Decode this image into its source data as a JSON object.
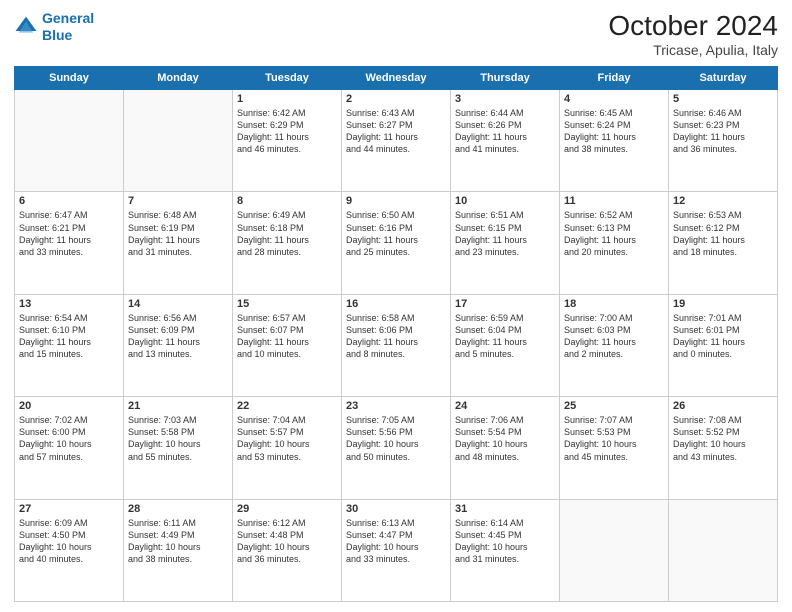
{
  "header": {
    "logo_line1": "General",
    "logo_line2": "Blue",
    "month": "October 2024",
    "location": "Tricase, Apulia, Italy"
  },
  "weekdays": [
    "Sunday",
    "Monday",
    "Tuesday",
    "Wednesday",
    "Thursday",
    "Friday",
    "Saturday"
  ],
  "weeks": [
    [
      {
        "day": "",
        "text": ""
      },
      {
        "day": "",
        "text": ""
      },
      {
        "day": "1",
        "text": "Sunrise: 6:42 AM\nSunset: 6:29 PM\nDaylight: 11 hours\nand 46 minutes."
      },
      {
        "day": "2",
        "text": "Sunrise: 6:43 AM\nSunset: 6:27 PM\nDaylight: 11 hours\nand 44 minutes."
      },
      {
        "day": "3",
        "text": "Sunrise: 6:44 AM\nSunset: 6:26 PM\nDaylight: 11 hours\nand 41 minutes."
      },
      {
        "day": "4",
        "text": "Sunrise: 6:45 AM\nSunset: 6:24 PM\nDaylight: 11 hours\nand 38 minutes."
      },
      {
        "day": "5",
        "text": "Sunrise: 6:46 AM\nSunset: 6:23 PM\nDaylight: 11 hours\nand 36 minutes."
      }
    ],
    [
      {
        "day": "6",
        "text": "Sunrise: 6:47 AM\nSunset: 6:21 PM\nDaylight: 11 hours\nand 33 minutes."
      },
      {
        "day": "7",
        "text": "Sunrise: 6:48 AM\nSunset: 6:19 PM\nDaylight: 11 hours\nand 31 minutes."
      },
      {
        "day": "8",
        "text": "Sunrise: 6:49 AM\nSunset: 6:18 PM\nDaylight: 11 hours\nand 28 minutes."
      },
      {
        "day": "9",
        "text": "Sunrise: 6:50 AM\nSunset: 6:16 PM\nDaylight: 11 hours\nand 25 minutes."
      },
      {
        "day": "10",
        "text": "Sunrise: 6:51 AM\nSunset: 6:15 PM\nDaylight: 11 hours\nand 23 minutes."
      },
      {
        "day": "11",
        "text": "Sunrise: 6:52 AM\nSunset: 6:13 PM\nDaylight: 11 hours\nand 20 minutes."
      },
      {
        "day": "12",
        "text": "Sunrise: 6:53 AM\nSunset: 6:12 PM\nDaylight: 11 hours\nand 18 minutes."
      }
    ],
    [
      {
        "day": "13",
        "text": "Sunrise: 6:54 AM\nSunset: 6:10 PM\nDaylight: 11 hours\nand 15 minutes."
      },
      {
        "day": "14",
        "text": "Sunrise: 6:56 AM\nSunset: 6:09 PM\nDaylight: 11 hours\nand 13 minutes."
      },
      {
        "day": "15",
        "text": "Sunrise: 6:57 AM\nSunset: 6:07 PM\nDaylight: 11 hours\nand 10 minutes."
      },
      {
        "day": "16",
        "text": "Sunrise: 6:58 AM\nSunset: 6:06 PM\nDaylight: 11 hours\nand 8 minutes."
      },
      {
        "day": "17",
        "text": "Sunrise: 6:59 AM\nSunset: 6:04 PM\nDaylight: 11 hours\nand 5 minutes."
      },
      {
        "day": "18",
        "text": "Sunrise: 7:00 AM\nSunset: 6:03 PM\nDaylight: 11 hours\nand 2 minutes."
      },
      {
        "day": "19",
        "text": "Sunrise: 7:01 AM\nSunset: 6:01 PM\nDaylight: 11 hours\nand 0 minutes."
      }
    ],
    [
      {
        "day": "20",
        "text": "Sunrise: 7:02 AM\nSunset: 6:00 PM\nDaylight: 10 hours\nand 57 minutes."
      },
      {
        "day": "21",
        "text": "Sunrise: 7:03 AM\nSunset: 5:58 PM\nDaylight: 10 hours\nand 55 minutes."
      },
      {
        "day": "22",
        "text": "Sunrise: 7:04 AM\nSunset: 5:57 PM\nDaylight: 10 hours\nand 53 minutes."
      },
      {
        "day": "23",
        "text": "Sunrise: 7:05 AM\nSunset: 5:56 PM\nDaylight: 10 hours\nand 50 minutes."
      },
      {
        "day": "24",
        "text": "Sunrise: 7:06 AM\nSunset: 5:54 PM\nDaylight: 10 hours\nand 48 minutes."
      },
      {
        "day": "25",
        "text": "Sunrise: 7:07 AM\nSunset: 5:53 PM\nDaylight: 10 hours\nand 45 minutes."
      },
      {
        "day": "26",
        "text": "Sunrise: 7:08 AM\nSunset: 5:52 PM\nDaylight: 10 hours\nand 43 minutes."
      }
    ],
    [
      {
        "day": "27",
        "text": "Sunrise: 6:09 AM\nSunset: 4:50 PM\nDaylight: 10 hours\nand 40 minutes."
      },
      {
        "day": "28",
        "text": "Sunrise: 6:11 AM\nSunset: 4:49 PM\nDaylight: 10 hours\nand 38 minutes."
      },
      {
        "day": "29",
        "text": "Sunrise: 6:12 AM\nSunset: 4:48 PM\nDaylight: 10 hours\nand 36 minutes."
      },
      {
        "day": "30",
        "text": "Sunrise: 6:13 AM\nSunset: 4:47 PM\nDaylight: 10 hours\nand 33 minutes."
      },
      {
        "day": "31",
        "text": "Sunrise: 6:14 AM\nSunset: 4:45 PM\nDaylight: 10 hours\nand 31 minutes."
      },
      {
        "day": "",
        "text": ""
      },
      {
        "day": "",
        "text": ""
      }
    ]
  ]
}
